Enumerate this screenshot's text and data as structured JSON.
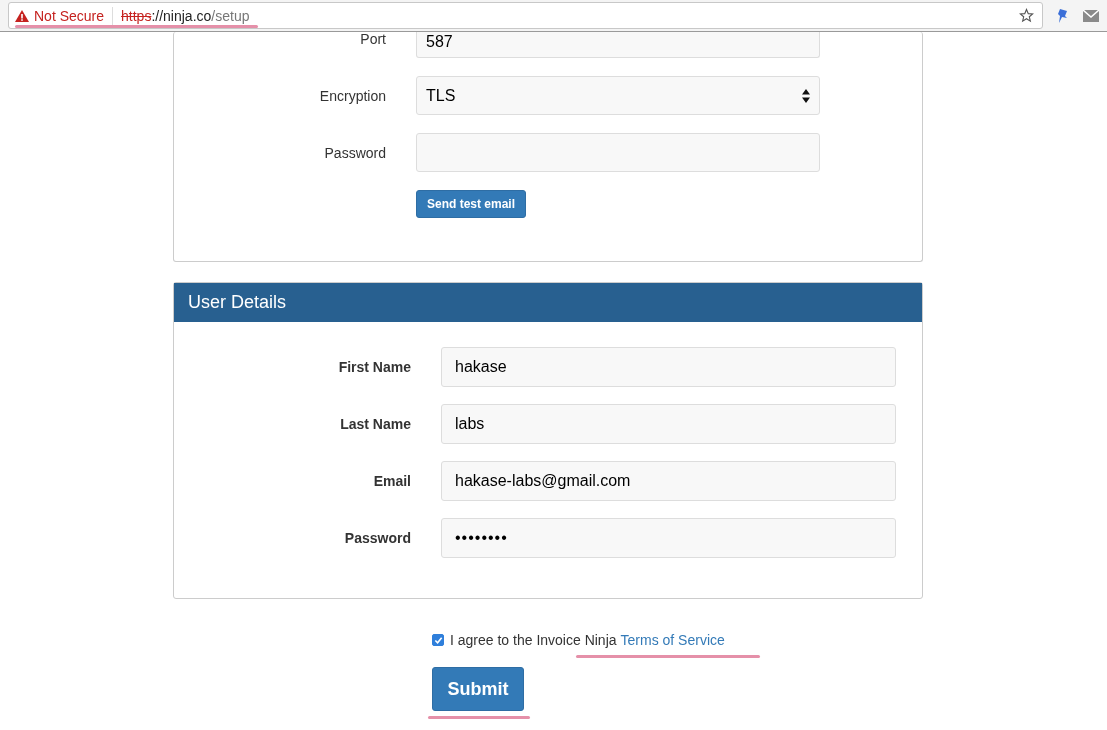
{
  "browser": {
    "security": "Not Secure",
    "url_scheme": "https",
    "url_rest": "://ninja.co",
    "url_path": "/setup"
  },
  "email_settings": {
    "fields": [
      {
        "kind": "input",
        "label": "Port",
        "value": "587"
      },
      {
        "kind": "select",
        "label": "Encryption",
        "value": "TLS"
      },
      {
        "kind": "input",
        "label": "Password"
      }
    ],
    "button": "Send test email"
  },
  "user_details": {
    "title": "User Details",
    "fields": [
      {
        "kind": "input",
        "label": "First Name",
        "value": "hakase"
      },
      {
        "kind": "input",
        "label": "Last Name",
        "value": "labs"
      },
      {
        "kind": "input",
        "label": "Email",
        "value": "hakase-labs@gmail.com"
      },
      {
        "kind": "password",
        "label": "Password",
        "value": "••••••••"
      }
    ]
  },
  "agreement": {
    "checked": true,
    "text": "I agree to the Invoice Ninja",
    "link": "Terms of Service"
  },
  "submit": "Submit"
}
